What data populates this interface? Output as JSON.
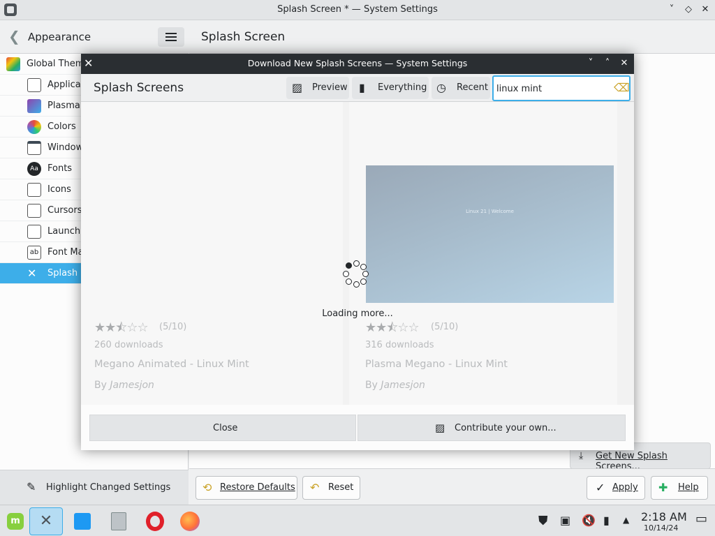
{
  "main_window": {
    "title": "Splash Screen * — System Settings",
    "controls": [
      "˅",
      "◇",
      "✕"
    ]
  },
  "sidebar": {
    "back_label": "Appearance",
    "items": [
      {
        "label": "Global Theme",
        "icon": "global-theme-icon"
      },
      {
        "label": "Applicat",
        "icon": "application-style-icon"
      },
      {
        "label": "Plasma",
        "icon": "plasma-style-icon"
      },
      {
        "label": "Colors",
        "icon": "colors-icon"
      },
      {
        "label": "Window",
        "icon": "window-decorations-icon"
      },
      {
        "label": "Fonts",
        "icon": "fonts-icon"
      },
      {
        "label": "Icons",
        "icon": "icons-icon"
      },
      {
        "label": "Cursors",
        "icon": "cursors-icon"
      },
      {
        "label": "Launch",
        "icon": "launch-feedback-icon"
      },
      {
        "label": "Font Ma",
        "icon": "font-management-icon"
      },
      {
        "label": "Splash S",
        "icon": "splash-screen-icon"
      }
    ],
    "highlight_label": "Highlight Changed Settings"
  },
  "content": {
    "title": "Splash Screen",
    "get_new_label": "Get New Splash Screens...",
    "footer": {
      "restore_label": "Restore Defaults",
      "reset_label": "Reset",
      "apply_label": "Apply",
      "help_label": "Help"
    }
  },
  "dialog": {
    "title": "Download New Splash Screens — System Settings",
    "heading": "Splash Screens",
    "toolbar": {
      "preview_label": "Preview",
      "everything_label": "Everything",
      "recent_label": "Recent"
    },
    "search": {
      "value": "linux mint"
    },
    "loading_text": "Loading more...",
    "cards": [
      {
        "rating": "(5/10)",
        "downloads": "260 downloads",
        "name": "Megano Animated - Linux Mint",
        "by_prefix": "By ",
        "author": "Jamesjon",
        "stars_filled": 2.5,
        "has_thumb": false
      },
      {
        "rating": "(5/10)",
        "downloads": "316 downloads",
        "name": "Plasma Megano - Linux Mint",
        "by_prefix": "By ",
        "author": "Jamesjon",
        "stars_filled": 2.5,
        "has_thumb": true,
        "thumb_caption": "Linux 21 | Welcome"
      }
    ],
    "close_label": "Close",
    "contribute_label": "Contribute your own..."
  },
  "taskbar": {
    "time": "2:18 AM",
    "date": "10/14/24"
  },
  "colors": {
    "accent": "#3daee9",
    "dialog_titlebar": "#2a2e32"
  }
}
